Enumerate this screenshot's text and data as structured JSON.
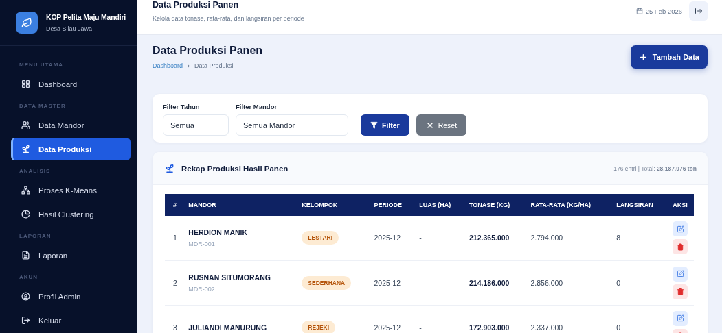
{
  "brand": {
    "name": "KOP Pelita Maju Mandiri",
    "subtitle": "Desa Silau Jawa"
  },
  "sidebar": {
    "sections": [
      {
        "label": "MENU UTAMA",
        "items": [
          {
            "label": "Dashboard",
            "selected": false
          }
        ]
      },
      {
        "label": "DATA MASTER",
        "items": [
          {
            "label": "Data Mandor",
            "selected": false
          },
          {
            "label": "Data Produksi",
            "selected": true
          }
        ]
      },
      {
        "label": "ANALISIS",
        "items": [
          {
            "label": "Proses K-Means",
            "selected": false
          },
          {
            "label": "Hasil Clustering",
            "selected": false
          }
        ]
      },
      {
        "label": "LAPORAN",
        "items": [
          {
            "label": "Laporan",
            "selected": false
          }
        ]
      },
      {
        "label": "AKUN",
        "items": [
          {
            "label": "Profil Admin",
            "selected": false
          },
          {
            "label": "Keluar",
            "selected": false
          }
        ]
      }
    ]
  },
  "topbar": {
    "title": "Data Produksi Panen",
    "subtitle": "Kelola data tonase, rata-rata, dan langsiran per periode",
    "date": "25 Feb 2026"
  },
  "page": {
    "title": "Data Produksi Panen",
    "breadcrumb": [
      "Dashboard",
      "Data Produksi"
    ],
    "add_button": "Tambah Data"
  },
  "filters": {
    "fields": [
      {
        "label": "Filter Tahun",
        "value": "Semua"
      },
      {
        "label": "Filter Mandor",
        "value": "Semua Mandor"
      }
    ],
    "filter_button": "Filter",
    "reset_button": "Reset"
  },
  "table": {
    "title": "Rekap Produksi Hasil Panen",
    "summary": "176 entri | Total: **28,187.976 ton**",
    "columns": [
      "#",
      "MANDOR",
      "KELOMPOK",
      "PERIODE",
      "LUAS (HA)",
      "TONASE (KG)",
      "RATA-RATA (KG/HA)",
      "LANGSIRAN",
      "AKSI"
    ],
    "rows": [
      {
        "no": "1",
        "name": "HERDION MANIK",
        "code": "MDR-001",
        "group": "LESTARI",
        "period": "2025-12",
        "area": "-",
        "tonnage": "212.365.000",
        "average": "2.794.000",
        "langsiran": "8"
      },
      {
        "no": "2",
        "name": "RUSNAN SITUMORANG",
        "code": "MDR-002",
        "group": "SEDERHANA",
        "period": "2025-12",
        "area": "-",
        "tonnage": "214.186.000",
        "average": "2.856.000",
        "langsiran": "0"
      },
      {
        "no": "3",
        "name": "JULIANDI MANURUNG",
        "group": "REJEKI",
        "period": "2025-12",
        "area": "-",
        "tonnage": "172.903.000",
        "average": "2.337.000",
        "langsiran": "0"
      }
    ]
  }
}
